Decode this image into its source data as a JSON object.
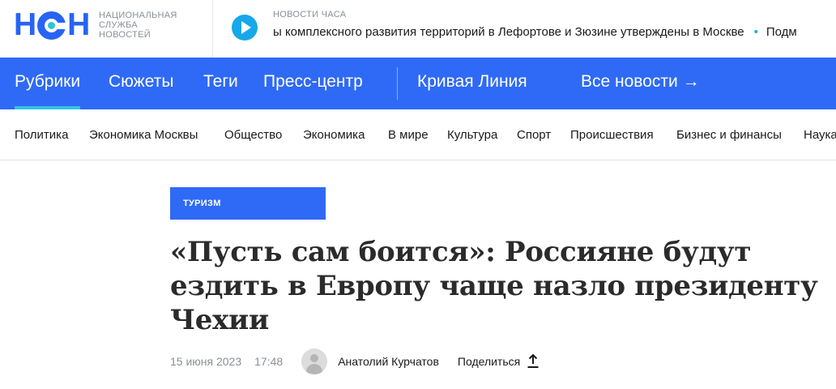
{
  "brand": {
    "logo_text_left": "Н",
    "logo_text_right": "Н",
    "subtitle_lines": [
      "НАЦИОНАЛЬНАЯ",
      "СЛУЖБА",
      "НОВОСТЕЙ"
    ],
    "accent_color": "#2f6af6",
    "secondary_color": "#2ec5d6"
  },
  "ticker": {
    "label": "НОВОСТИ ЧАСА",
    "play_icon": "play-icon",
    "items": [
      "ы комплексного развития территорий в Лефортове и Зюзине утверждены в Москве",
      "Подм"
    ]
  },
  "main_nav": {
    "items": [
      "Рубрики",
      "Сюжеты",
      "Теги",
      "Пресс-центр",
      "Кривая Линия",
      "Все новости →"
    ],
    "active_index": 0
  },
  "rubrics": [
    "Политика",
    "Экономика Москвы",
    "Общество",
    "Экономика",
    "В мире",
    "Культура",
    "Спорт",
    "Происшествия",
    "Бизнес и финансы",
    "Наука"
  ],
  "article": {
    "tag": "ТУРИЗМ",
    "headline": "«Пусть сам боится»: Россияне будут ездить в Европу чаще назло президенту Чехии",
    "date": "15 июня 2023",
    "time": "17:48",
    "author": "Анатолий Курчатов",
    "share_label": "Поделиться",
    "share_icon": "share-icon",
    "avatar_icon": "user-avatar-icon"
  }
}
